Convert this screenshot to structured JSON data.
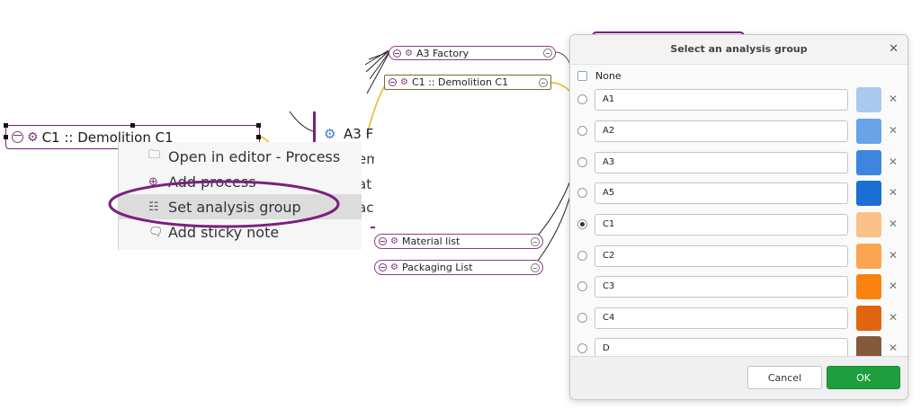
{
  "diagram": {
    "selected_node": {
      "label": "C1 :: Demolition C1"
    },
    "top_nodes": [
      {
        "label": "A3 Factory"
      },
      {
        "label": "C1 :: Demolition C1"
      }
    ],
    "bottom_nodes": [
      {
        "label": "Material list"
      },
      {
        "label": "Packaging List"
      }
    ],
    "partial_node": {
      "title": "A3 F",
      "lines": [
        "em",
        "at",
        "acl"
      ]
    }
  },
  "context_menu": {
    "items": [
      {
        "label": "Open in editor - Process",
        "icon": "folder-icon"
      },
      {
        "label": "Add process",
        "icon": "add-process-icon"
      },
      {
        "label": "Set analysis group",
        "icon": "list-icon",
        "highlighted": true
      },
      {
        "label": "Add sticky note",
        "icon": "sticky-note-icon"
      }
    ]
  },
  "dialog": {
    "title": "Select an analysis group",
    "none_label": "None",
    "groups": [
      {
        "name": "A1",
        "color": "#a9c9ef",
        "selected": false
      },
      {
        "name": "A2",
        "color": "#6aa3e8",
        "selected": false
      },
      {
        "name": "A3",
        "color": "#3d86e0",
        "selected": false
      },
      {
        "name": "A5",
        "color": "#1b6fd4",
        "selected": false
      },
      {
        "name": "C1",
        "color": "#fcc187",
        "selected": true
      },
      {
        "name": "C2",
        "color": "#fca551",
        "selected": false
      },
      {
        "name": "C3",
        "color": "#fb8110",
        "selected": false
      },
      {
        "name": "C4",
        "color": "#e06510",
        "selected": false
      },
      {
        "name": "D",
        "color": "#86593a",
        "selected": false
      }
    ],
    "cancel_label": "Cancel",
    "ok_label": "OK"
  },
  "colors": {
    "node_border": "#8e3a8f",
    "highlight_ring": "#7b1f7e",
    "ok_button": "#1e9e3c"
  }
}
